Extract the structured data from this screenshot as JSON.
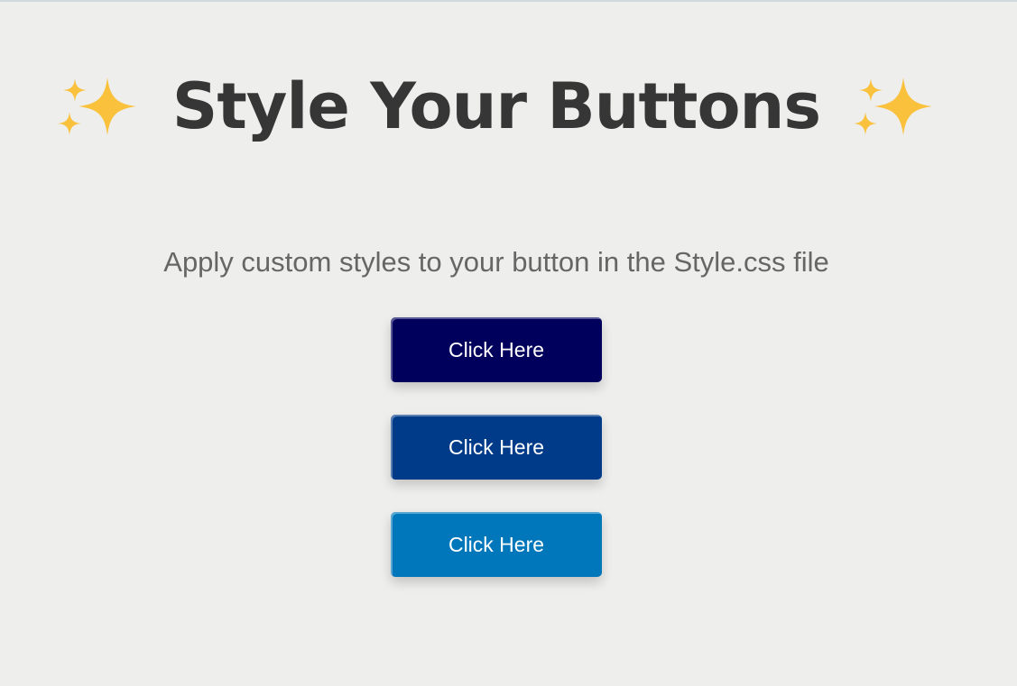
{
  "header": {
    "title": "Style Your Buttons",
    "left_icon": "sparkles-icon",
    "right_icon": "sparkles-icon",
    "icon_color": "#F9C13C"
  },
  "subtitle": "Apply custom styles to your button in the Style.css file",
  "buttons": [
    {
      "label": "Click Here",
      "color": "#00005C"
    },
    {
      "label": "Click Here",
      "color": "#003B8A"
    },
    {
      "label": "Click Here",
      "color": "#0077BA"
    }
  ]
}
